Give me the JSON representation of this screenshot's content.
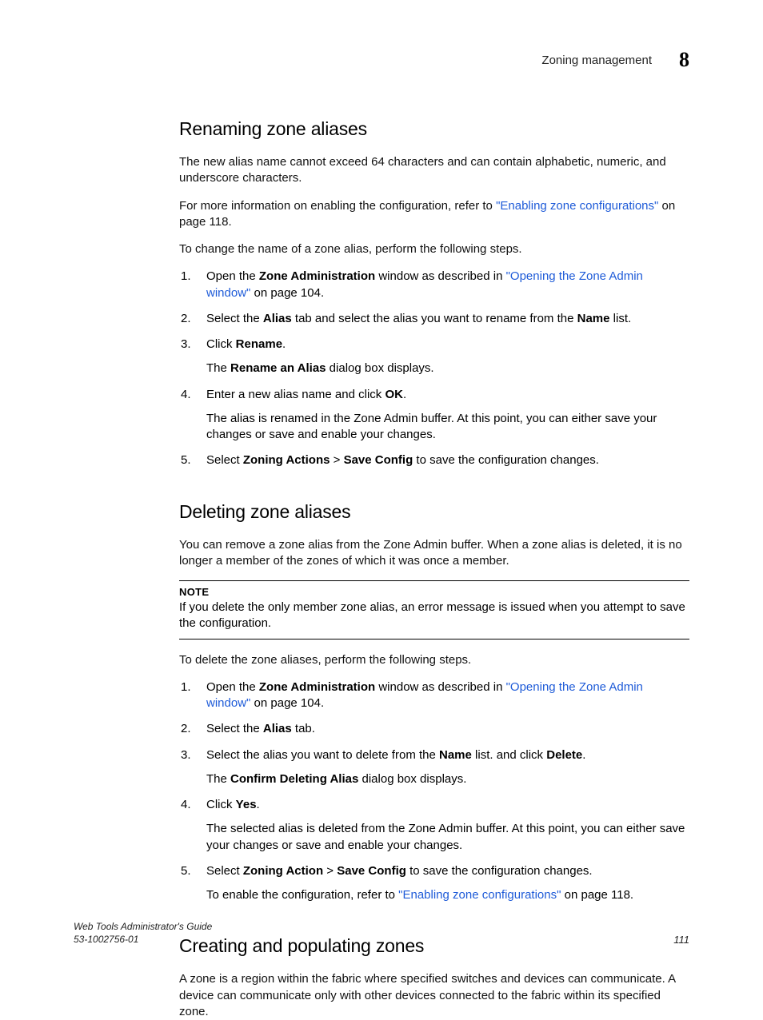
{
  "header": {
    "running_head": "Zoning management",
    "chapter_number": "8"
  },
  "s1": {
    "title": "Renaming zone aliases",
    "p1": "The new alias name cannot exceed 64 characters and can contain alphabetic, numeric, and underscore characters.",
    "p2a": "For more information on enabling the configuration, refer to ",
    "p2link": "\"Enabling zone configurations\"",
    "p2b": " on page 118.",
    "p3": "To change the name of a zone alias, perform the following steps.",
    "li1a": "Open the ",
    "li1b": "Zone Administration",
    "li1c": " window as described in ",
    "li1link": "\"Opening the Zone Admin window\"",
    "li1d": " on page 104.",
    "li2a": "Select the ",
    "li2b": "Alias",
    "li2c": " tab and select the alias you want to rename from the ",
    "li2d": "Name",
    "li2e": " list.",
    "li3a": "Click ",
    "li3b": "Rename",
    "li3c": ".",
    "li3sub_a": "The ",
    "li3sub_b": "Rename an Alias",
    "li3sub_c": " dialog box displays.",
    "li4a": "Enter a new alias name and click ",
    "li4b": "OK",
    "li4c": ".",
    "li4sub": "The alias is renamed in the Zone Admin buffer. At this point, you can either save your changes or save and enable your changes.",
    "li5a": "Select ",
    "li5b": "Zoning Actions",
    "li5c": " > ",
    "li5d": "Save Config",
    "li5e": " to save the configuration changes."
  },
  "s2": {
    "title": "Deleting zone aliases",
    "p1": "You can remove a zone alias from the Zone Admin buffer. When a zone alias is deleted, it is no longer a member of the zones of which it was once a member.",
    "note_label": "NOTE",
    "note_body": "If you delete the only member zone alias, an error message is issued when you attempt to save the configuration.",
    "p2": "To delete the zone aliases, perform the following steps.",
    "li1a": "Open the ",
    "li1b": "Zone Administration",
    "li1c": " window as described in ",
    "li1link": "\"Opening the Zone Admin window\"",
    "li1d": " on page 104.",
    "li2a": "Select the ",
    "li2b": "Alias",
    "li2c": " tab.",
    "li3a": "Select the alias you want to delete from the ",
    "li3b": "Name",
    "li3c": " list. and click ",
    "li3d": "Delete",
    "li3e": ".",
    "li3sub_a": "The ",
    "li3sub_b": "Confirm Deleting Alias",
    "li3sub_c": " dialog box displays.",
    "li4a": "Click ",
    "li4b": "Yes",
    "li4c": ".",
    "li4sub": "The selected alias is deleted from the Zone Admin buffer. At this point, you can either save your changes or save and enable your changes.",
    "li5a": "Select ",
    "li5b": "Zoning Action",
    "li5c": " > ",
    "li5d": "Save Config",
    "li5e": " to save the configuration changes.",
    "li5sub_a": "To enable the configuration, refer to ",
    "li5sub_link": "\"Enabling zone configurations\"",
    "li5sub_b": " on page 118."
  },
  "s3": {
    "title": "Creating and populating zones",
    "p1": "A zone is a region within the fabric where specified switches and devices can communicate. A device can communicate only with other devices connected to the fabric within its specified zone."
  },
  "footer": {
    "doc_title": "Web Tools Administrator's Guide",
    "doc_id": "53-1002756-01",
    "page_number": "111"
  }
}
